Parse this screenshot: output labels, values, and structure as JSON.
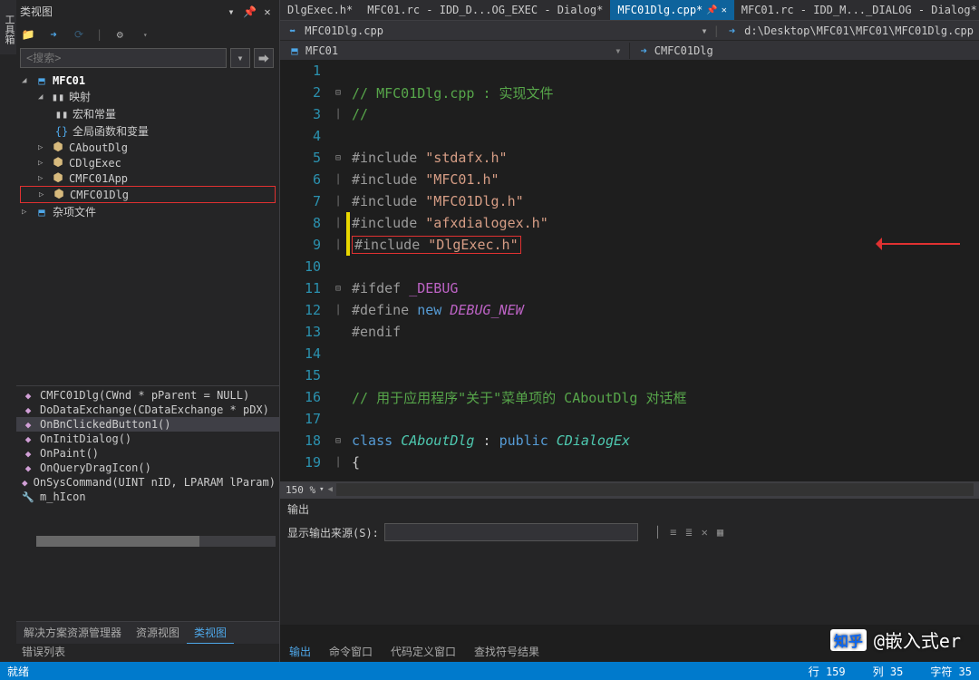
{
  "sidebar": {
    "vertical_label": "工具箱",
    "panel_title": "类视图",
    "search_placeholder": "<搜索>",
    "tree": {
      "root": "MFC01",
      "items": [
        "映射",
        "宏和常量",
        "全局函数和变量",
        "CAboutDlg",
        "CDlgExec",
        "CMFC01App",
        "CMFC01Dlg",
        "杂项文件"
      ]
    },
    "members": [
      "CMFC01Dlg(CWnd * pParent = NULL)",
      "DoDataExchange(CDataExchange * pDX)",
      "OnBnClickedButton1()",
      "OnInitDialog()",
      "OnPaint()",
      "OnQueryDragIcon()",
      "OnSysCommand(UINT nID, LPARAM lParam)",
      "m_hIcon"
    ],
    "bottom_tabs": [
      "解决方案资源管理器",
      "资源视图",
      "类视图"
    ],
    "error_list": "错误列表"
  },
  "editor": {
    "tabs": [
      "DlgExec.h*",
      "MFC01.rc - IDD_D...OG_EXEC - Dialog*",
      "MFC01Dlg.cpp*",
      "MFC01.rc - IDD_M..._DIALOG - Dialog*"
    ],
    "nav_file": "MFC01Dlg.cpp",
    "nav_path": "d:\\Desktop\\MFC01\\MFC01\\MFC01Dlg.cpp",
    "class_left": "MFC01",
    "class_right": "CMFC01Dlg",
    "zoom": "150 %",
    "lines": {
      "l2": "// MFC01Dlg.cpp : 实现文件",
      "l3": "//",
      "inc": "#include ",
      "s5": "\"stdafx.h\"",
      "s6": "\"MFC01.h\"",
      "s7": "\"MFC01Dlg.h\"",
      "s8": "\"afxdialogex.h\"",
      "s9": "\"DlgExec.h\"",
      "ifdef": "#ifdef ",
      "debug": "_DEBUG",
      "define": "#define ",
      "newk": "new ",
      "dnew": "DEBUG_NEW",
      "endif": "#endif",
      "l16": "// 用于应用程序\"关于\"菜单项的 CAboutDlg 对话框",
      "classk": "class ",
      "caboutdlg": "CAboutDlg",
      "colon": " : ",
      "publick": "public ",
      "cdialogex": "CDialogEx",
      "brace": "{"
    }
  },
  "output": {
    "title": "输出",
    "label": "显示输出来源(S):",
    "tabs": [
      "输出",
      "命令窗口",
      "代码定义窗口",
      "查找符号结果"
    ]
  },
  "status": {
    "ready": "就绪",
    "line": "行 159",
    "col": "列 35",
    "char": "字符 35"
  },
  "watermark": "@嵌入式er",
  "zhihu": "知乎"
}
